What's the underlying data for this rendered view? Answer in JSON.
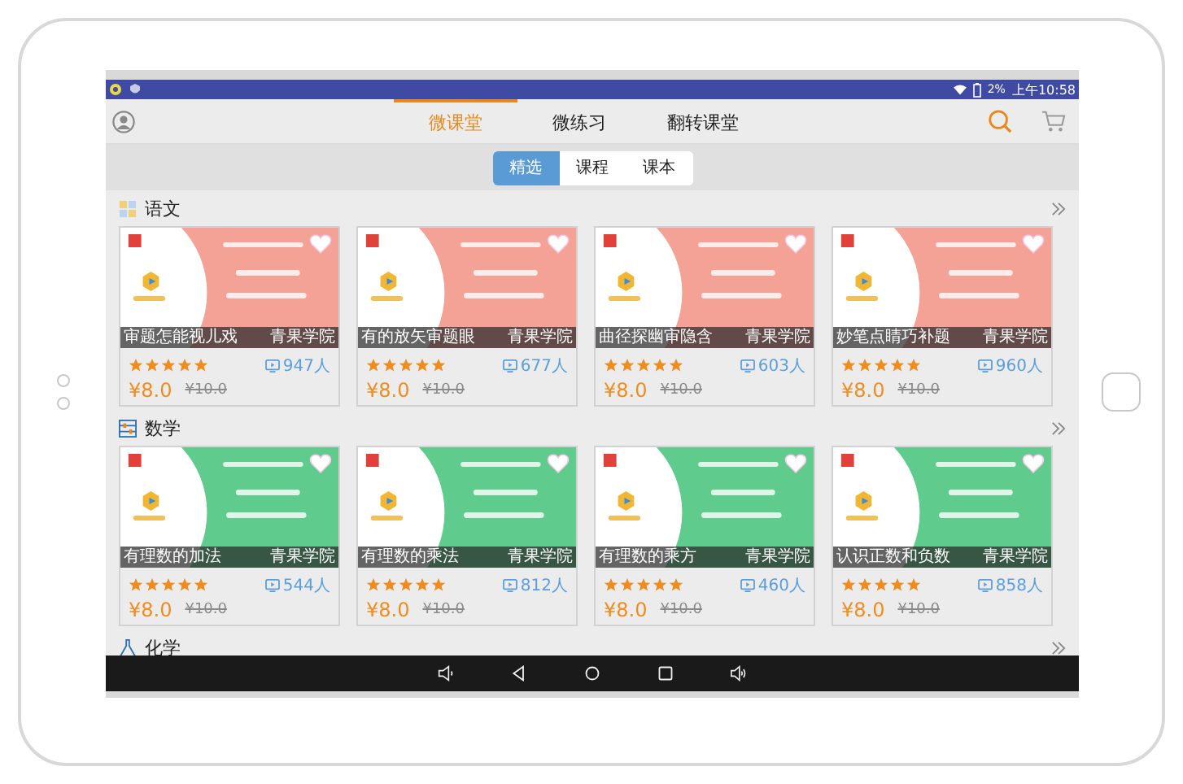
{
  "status_bar": {
    "battery": "2%",
    "time": "上午10:58"
  },
  "top_tabs": [
    {
      "label": "微课堂",
      "selected": true
    },
    {
      "label": "微练习",
      "selected": false
    },
    {
      "label": "翻转课堂",
      "selected": false
    }
  ],
  "sub_tabs": [
    {
      "label": "精选",
      "selected": true
    },
    {
      "label": "课程",
      "selected": false
    },
    {
      "label": "课本",
      "selected": false
    }
  ],
  "sections": [
    {
      "title": "语文",
      "kind": "chinese",
      "color": "#f4a196",
      "courses": [
        {
          "title": "审题怎能视儿戏",
          "publisher": "青果学院",
          "stars": 5,
          "learners": "947人",
          "price": "¥8.0",
          "original_price": "¥10.0"
        },
        {
          "title": "有的放矢审题眼",
          "publisher": "青果学院",
          "stars": 5,
          "learners": "677人",
          "price": "¥8.0",
          "original_price": "¥10.0"
        },
        {
          "title": "曲径探幽审隐含",
          "publisher": "青果学院",
          "stars": 5,
          "learners": "603人",
          "price": "¥8.0",
          "original_price": "¥10.0"
        },
        {
          "title": "妙笔点睛巧补题",
          "publisher": "青果学院",
          "stars": 5,
          "learners": "960人",
          "price": "¥8.0",
          "original_price": "¥10.0"
        }
      ]
    },
    {
      "title": "数学",
      "kind": "math",
      "color": "#5fcb8c",
      "courses": [
        {
          "title": "有理数的加法",
          "publisher": "青果学院",
          "stars": 5,
          "learners": "544人",
          "price": "¥8.0",
          "original_price": "¥10.0"
        },
        {
          "title": "有理数的乘法",
          "publisher": "青果学院",
          "stars": 5,
          "learners": "812人",
          "price": "¥8.0",
          "original_price": "¥10.0"
        },
        {
          "title": "有理数的乘方",
          "publisher": "青果学院",
          "stars": 5,
          "learners": "460人",
          "price": "¥8.0",
          "original_price": "¥10.0"
        },
        {
          "title": "认识正数和负数",
          "publisher": "青果学院",
          "stars": 5,
          "learners": "858人",
          "price": "¥8.0",
          "original_price": "¥10.0"
        }
      ]
    },
    {
      "title": "化学",
      "kind": "chemistry"
    }
  ]
}
